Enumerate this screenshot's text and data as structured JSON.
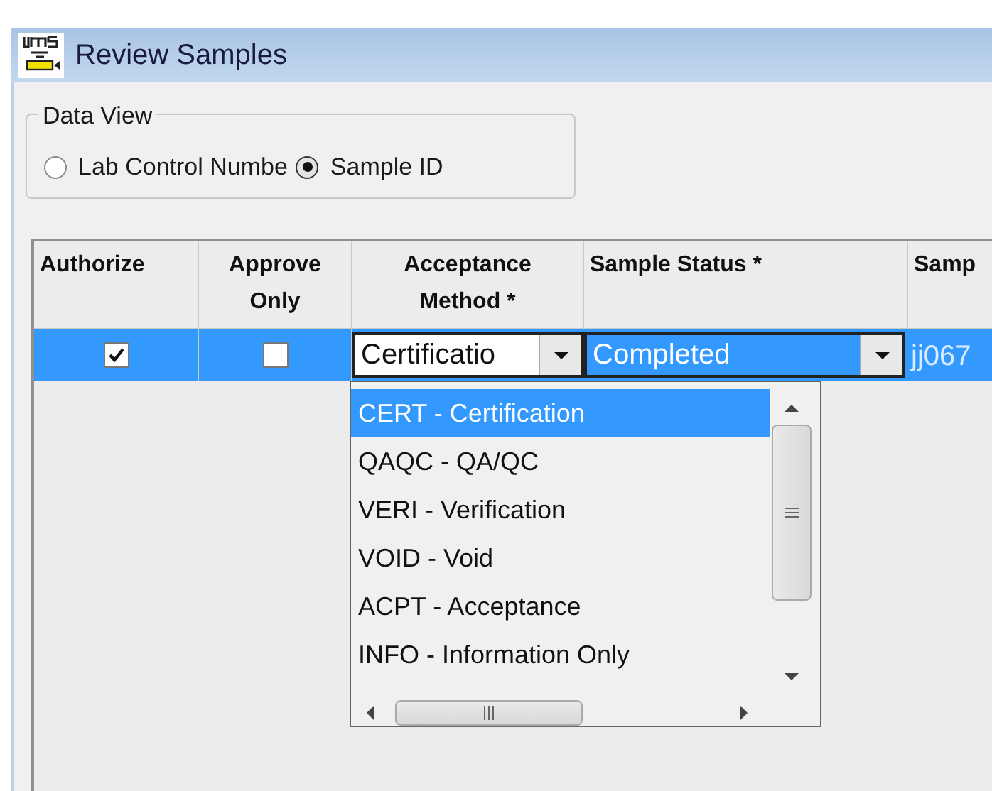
{
  "window": {
    "title": "Review Samples"
  },
  "data_view": {
    "title": "Data View",
    "options": [
      {
        "label": "Lab Control Numbe",
        "selected": false
      },
      {
        "label": "Sample ID",
        "selected": true
      }
    ]
  },
  "grid": {
    "columns": [
      "Authorize",
      "Approve Only",
      "Acceptance Method *",
      "Sample Status *",
      "Samp"
    ],
    "rows": [
      {
        "authorize": true,
        "approve_only": false,
        "acceptance_method": "Certificatio",
        "sample_status": "Completed",
        "column_5": "jj067",
        "selected": true
      }
    ]
  },
  "dropdown": {
    "items": [
      {
        "label": "CERT - Certification",
        "selected": true
      },
      {
        "label": "QAQC - QA/QC",
        "selected": false
      },
      {
        "label": "VERI - Verification",
        "selected": false
      },
      {
        "label": "VOID - Void",
        "selected": false
      },
      {
        "label": "ACPT - Acceptance",
        "selected": false
      },
      {
        "label": "INFO - Information Only",
        "selected": false
      }
    ]
  }
}
